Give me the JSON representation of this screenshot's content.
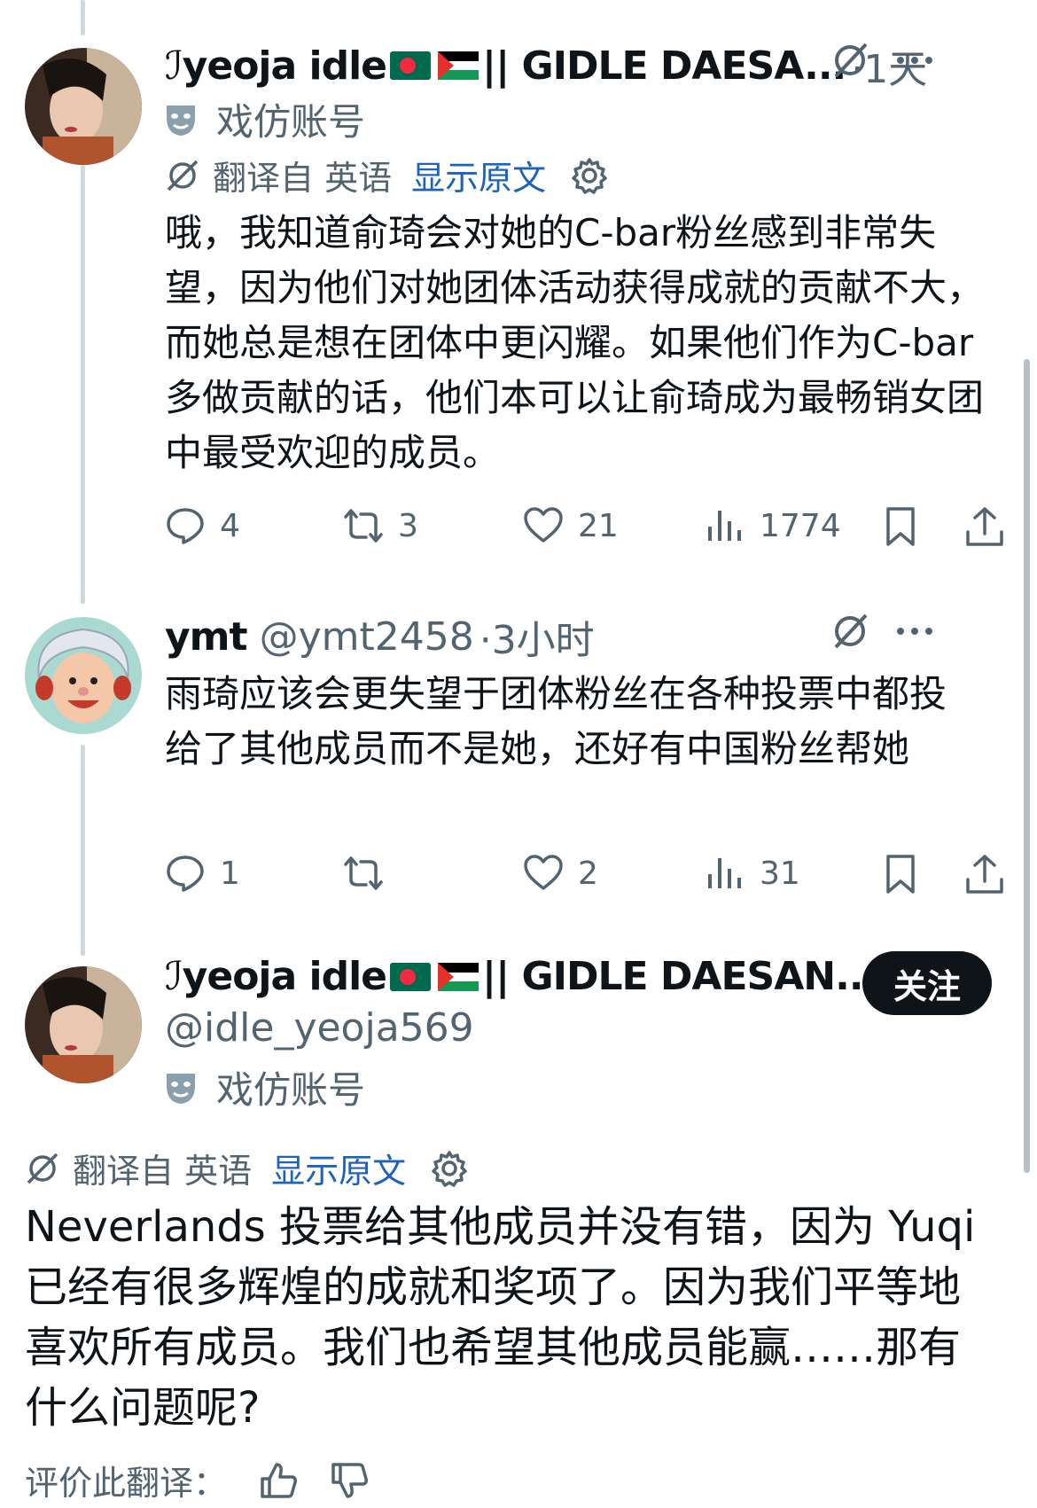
{
  "colors": {
    "link": "#1d64b8",
    "muted": "#536471",
    "text": "#0f1419",
    "thread_line": "#cfd9de",
    "button_bg": "#0f1419"
  },
  "reply1": {
    "prefix_glyph": "ℐ",
    "display_name": "yeoja idle",
    "flag_suffix": "|| GIDLE DAESA...",
    "time": "·1天",
    "parody_label": "戏仿账号",
    "translated_from": "翻译自 英语",
    "show_original": "显示原文",
    "text": "哦，我知道俞琦会对她的C-bar粉丝感到非常失望，因为他们对她团体活动获得成就的贡献不大，而她总是想在团体中更闪耀。如果他们作为C-bar多做贡献的话，他们本可以让俞琦成为最畅销女团中最受欢迎的成员。",
    "stats": {
      "replies": "4",
      "reposts": "3",
      "likes": "21",
      "views": "1774"
    }
  },
  "reply2": {
    "display_name": "ymt",
    "handle": "@ymt2458",
    "time": "·3小时",
    "text": "雨琦应该会更失望于团体粉丝在各种投票中都投给了其他成员而不是她，还好有中国粉丝帮她",
    "stats": {
      "replies": "1",
      "reposts": "",
      "likes": "2",
      "views": "31"
    }
  },
  "main_post": {
    "prefix_glyph": "ℐ",
    "display_name": "yeoja idle",
    "flag_suffix": "|| GIDLE DAESAN...",
    "handle": "@idle_yeoja569",
    "follow_label": "关注",
    "parody_label": "戏仿账号",
    "translated_from": "翻译自 英语",
    "show_original": "显示原文",
    "text": "Neverlands 投票给其他成员并没有错，因为 Yuqi 已经有很多辉煌的成就和奖项了。因为我们平等地喜欢所有成员。我们也希望其他成员能赢……那有什么问题呢?",
    "rate_translation": "评价此翻译："
  }
}
